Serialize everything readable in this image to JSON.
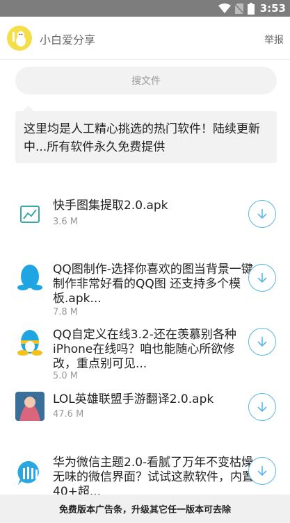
{
  "status_bar": {
    "time": "3:53"
  },
  "header": {
    "username": "小白爱分享",
    "report_label": "举报"
  },
  "search": {
    "placeholder": "搜文件"
  },
  "notice": {
    "text": "这里均是人工精心挑选的热门软件！陆续更新中...所有软件永久免费提供"
  },
  "files": [
    {
      "title": "快手图集提取2.0.apk",
      "size": "3.6 M",
      "icon": "chart-icon"
    },
    {
      "title": "QQ图制作-选择你喜欢的图当背景一键制作非常好看的QQ图 还支持多个模板.apk...",
      "size": "7.8 M",
      "icon": "qq-penguin-icon"
    },
    {
      "title": "QQ自定义在线3.2-还在羡慕别各种iPhone在线吗？咱也能随心所欲修改，重点别可见...",
      "size": "5.0 M",
      "icon": "qq-penguin-icon"
    },
    {
      "title": "LOL英雄联盟手游翻译2.0.apk",
      "size": "47.6 M",
      "icon": "game-character-icon"
    },
    {
      "title": "华为微信主题2.0-看腻了万年不变枯燥无味的微信界面？试试这款软件，内置40+超...",
      "size": "",
      "icon": "chat-theme-icon"
    }
  ],
  "ad_bar": {
    "text": "免费版本广告条，升级其它任一版本可去除"
  },
  "colors": {
    "accent": "#5ab5e5",
    "statusbar": "#7d7d7d"
  }
}
